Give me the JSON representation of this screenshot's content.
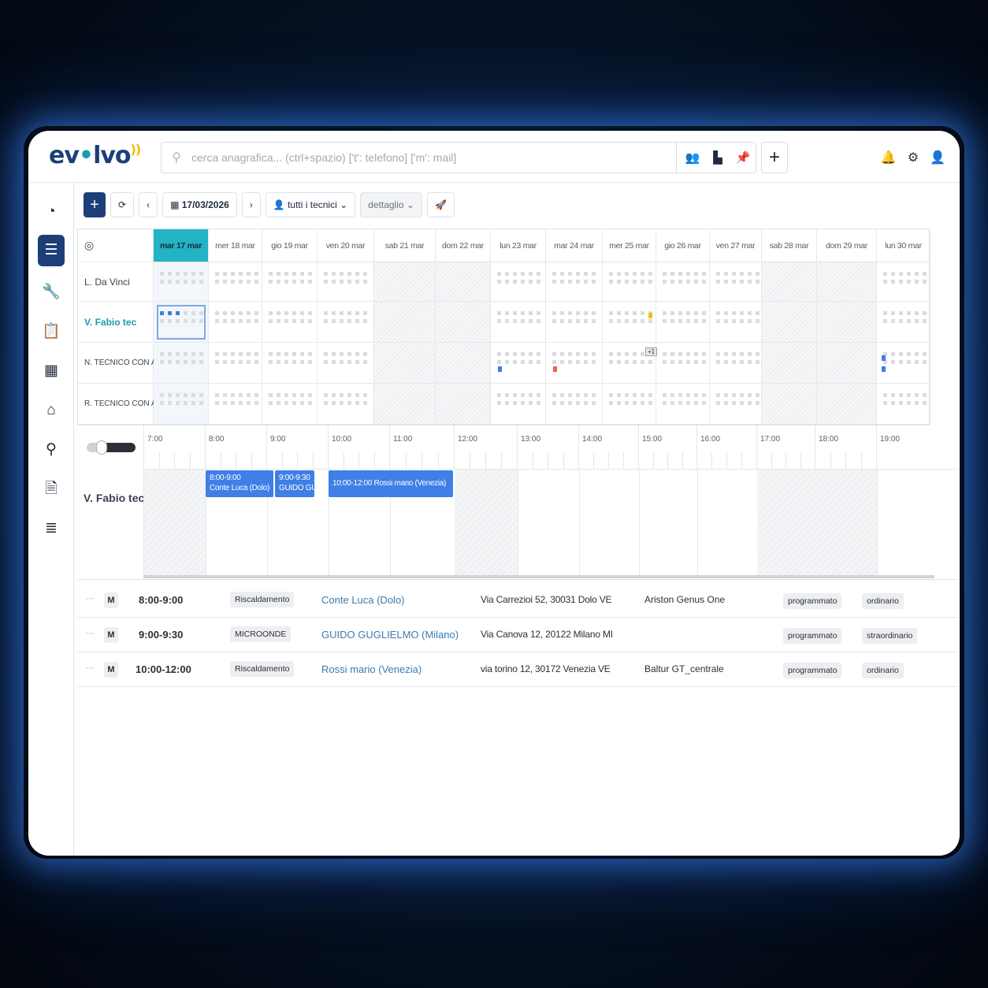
{
  "search": {
    "placeholder": "cerca anagrafica... (ctrl+spazio) ['t': telefono] ['m': mail]"
  },
  "logo": {
    "text": "ev•lvo"
  },
  "toolbar": {
    "add": "+",
    "refresh": "⟳",
    "prev": "‹",
    "date": "17/03/2026",
    "next": "›",
    "technicians": "tutti i tecnici",
    "view": "dettaglio"
  },
  "week": {
    "days": [
      "mar 17 mar",
      "mer 18 mar",
      "gio 19 mar",
      "ven 20 mar",
      "sab 21 mar",
      "dom 22 mar",
      "lun 23 mar",
      "mar 24 mar",
      "mer 25 mar",
      "gio 26 mar",
      "ven 27 mar",
      "sab 28 mar",
      "dom 29 mar",
      "lun 30 mar"
    ],
    "technicians": [
      "L. Da Vinci",
      "V. Fabio tec",
      "N. TECNICO CON A",
      "R. TECNICO CON A"
    ],
    "more_badge": "+1"
  },
  "timeline": {
    "hours": [
      "7:00",
      "8:00",
      "9:00",
      "10:00",
      "11:00",
      "12:00",
      "13:00",
      "14:00",
      "15:00",
      "16:00",
      "17:00",
      "18:00",
      "19:00"
    ],
    "technician": "V. Fabio tec",
    "events": [
      {
        "line1": "8:00-9:00",
        "line2": "Conte Luca (Dolo)"
      },
      {
        "line1": "9:00-9:30",
        "line2": "GUIDO GU"
      },
      {
        "line1": "10:00-12:00  Rossi mario (Venezia)",
        "line2": ""
      }
    ]
  },
  "list": [
    {
      "more": "···",
      "tag": "M",
      "time": "8:00-9:00",
      "type": "Riscaldamento",
      "client": "Conte Luca (Dolo)",
      "address": "Via Carrezioi 52, 30031 Dolo VE",
      "product": "Ariston Genus One",
      "status": "programmato",
      "kind": "ordinario"
    },
    {
      "more": "···",
      "tag": "M",
      "time": "9:00-9:30",
      "type": "MICROONDE",
      "client": "GUIDO GUGLIELMO (Milano)",
      "address": "Via Canova 12, 20122 Milano MI",
      "product": "",
      "status": "programmato",
      "kind": "straordinario"
    },
    {
      "more": "···",
      "tag": "M",
      "time": "10:00-12:00",
      "type": "Riscaldamento",
      "client": "Rossi mario (Venezia)",
      "address": "via torino 12, 30172 Venezia VE",
      "product": "Baltur GT_centrale",
      "status": "programmato",
      "kind": "ordinario"
    }
  ],
  "colors": {
    "brand": "#1d3f77",
    "today": "#22b3c4",
    "event": "#3f7fe6",
    "link": "#3a7bb0"
  }
}
